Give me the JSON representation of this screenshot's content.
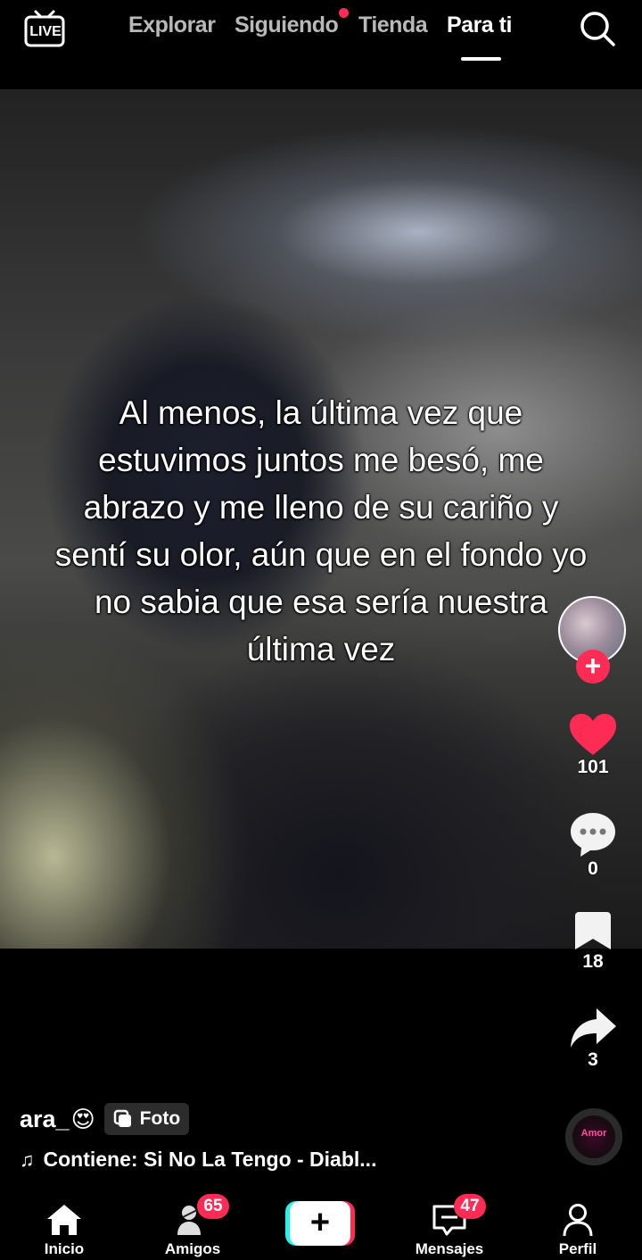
{
  "header": {
    "live_label": "LIVE",
    "tabs": [
      {
        "label": "Explorar",
        "active": false
      },
      {
        "label": "Siguiendo",
        "active": false,
        "has_dot": true
      },
      {
        "label": "Tienda",
        "active": false
      },
      {
        "label": "Para ti",
        "active": true
      }
    ]
  },
  "video": {
    "caption": "Al menos, la última vez que estuvimos juntos me besó, me abrazo y me lleno de su cariño y sentí su olor, aún que en el fondo yo no sabia que esa sería nuestra última vez"
  },
  "rail": {
    "likes": "101",
    "comments": "0",
    "saves": "18",
    "shares": "3",
    "follow_symbol": "+",
    "disc_text": "Amor"
  },
  "post": {
    "username": "ara_",
    "username_emoji": "😍",
    "type_badge": "Foto",
    "music": "Contiene: Si No La Tengo - Diabl..."
  },
  "nav": {
    "items": [
      {
        "label": "Inicio"
      },
      {
        "label": "Amigos",
        "badge": "65"
      },
      {
        "label": "Mensajes",
        "badge": "47"
      },
      {
        "label": "Perfil"
      }
    ],
    "create_symbol": "+"
  },
  "colors": {
    "accent": "#fe2c55",
    "cyan": "#25f4ee",
    "background": "#000000"
  }
}
